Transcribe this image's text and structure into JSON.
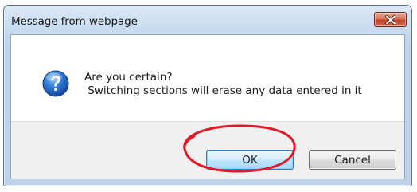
{
  "dialog": {
    "title": "Message from webpage",
    "message_line1": "Are you certain?",
    "message_line2": " Switching sections will erase any data entered in it",
    "ok_label": "OK",
    "cancel_label": "Cancel",
    "icon": "question-icon"
  },
  "window_controls": {
    "close_icon": "close-icon"
  },
  "colors": {
    "close_button": "#c1432a",
    "highlight_ellipse": "#e0192a",
    "question_icon": "#1f62b8",
    "ok_button_border": "#2f7fc7",
    "button_area": "#f0f0f0"
  }
}
